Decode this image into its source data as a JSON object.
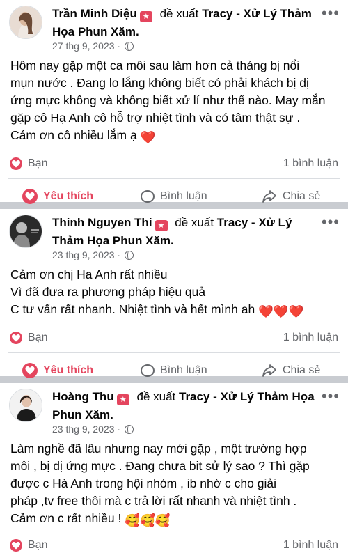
{
  "posts": [
    {
      "author": "Trần Minh Diệu",
      "recommend_text": "đề xuất",
      "page": "Tracy - Xử Lý Thảm Họa Phun Xăm.",
      "date": "27 thg 9, 2023",
      "separator": "·",
      "lines": [
        "Hôm nay gặp một ca môi sau làm hơn cả tháng bị nổi",
        "mụn nước . Đang lo lắng không biết có phải khách bị dị",
        "ứng mực không và không biết xử lí như thế nào. May mắn",
        "gặp cô Hạ Anh cô hỗ trợ nhiệt tình và có tâm thật sự .",
        "Cám ơn cô nhiều lắm ạ"
      ],
      "emoji_tail": "❤️",
      "reaction_label": "Bạn",
      "comment_count": "1 bình luận"
    },
    {
      "author": "Thinh Nguyen Thi",
      "recommend_text": "đề xuất",
      "page": "Tracy - Xử Lý Thảm Họa Phun Xăm.",
      "date": "23 thg 9, 2023",
      "separator": "·",
      "lines": [
        "Cảm ơn chị Ha Anh rất nhiều",
        "Vì đã đưa ra phương pháp hiệu quả",
        "C tư vấn rất nhanh. Nhiệt tình và hết mình ah"
      ],
      "emoji_tail": "❤️❤️❤️",
      "reaction_label": "Bạn",
      "comment_count": "1 bình luận"
    },
    {
      "author": "Hoàng Thu",
      "recommend_text": "đề xuất",
      "page": "Tracy - Xử Lý Thảm Họa Phun Xăm.",
      "date": "23 thg 9, 2023",
      "separator": "·",
      "lines": [
        "Làm nghề đã lâu nhưng nay mới gặp , một trường hợp",
        "môi , bị dị ứng mực . Đang chưa bit sử lý sao ? Thì gặp",
        "được c Hà Anh trong hội nhóm , ib nhờ c cho giải",
        "pháp ,tv free thôi mà c trả lời rất nhanh và nhiệt tình .",
        "Cảm ơn c rất nhiều !"
      ],
      "emoji_tail": "🥰🥰🥰",
      "reaction_label": "Bạn",
      "comment_count": "1 bình luận"
    }
  ],
  "actions": {
    "like": "Yêu thích",
    "comment": "Bình luận",
    "share": "Chia sẻ"
  },
  "colors": {
    "accent": "#e4455e",
    "muted": "#65676b",
    "separator": "#c9ccd1"
  },
  "icons": [
    "heart-icon",
    "comment-bubble-icon",
    "share-arrow-icon",
    "globe-icon",
    "more-icon",
    "recommend-star-icon"
  ]
}
